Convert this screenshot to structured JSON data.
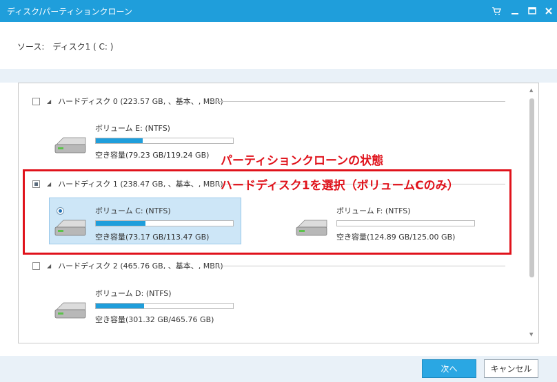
{
  "window": {
    "title": "ディスク/パーティションクローン",
    "icons": [
      "cart-icon",
      "minimize-icon",
      "maximize-icon",
      "close-icon"
    ]
  },
  "source_label": "ソース:　ディスク1 ( C: )",
  "disks": [
    {
      "label": "ハードディスク 0 (223.57 GB, 、基本、, MBR)",
      "checked": "unchecked",
      "volumes": [
        {
          "name": "ボリューム E: (NTFS)",
          "capacity": "空き容量(79.23 GB/119.24 GB)",
          "used_fraction": 0.34
        }
      ]
    },
    {
      "label": "ハードディスク 1 (238.47 GB, 、基本、, MBR)",
      "checked": "partial",
      "volumes": [
        {
          "name": "ボリューム C: (NTFS)",
          "capacity": "空き容量(73.17 GB/113.47 GB)",
          "used_fraction": 0.36,
          "selected": true
        },
        {
          "name": "ボリューム F: (NTFS)",
          "capacity": "空き容量(124.89 GB/125.00 GB)",
          "used_fraction": 0.0
        }
      ]
    },
    {
      "label": "ハードディスク 2 (465.76 GB, 、基本、, MBR)",
      "checked": "unchecked",
      "volumes": [
        {
          "name": "ボリューム D: (NTFS)",
          "capacity": "空き容量(301.32 GB/465.76 GB)",
          "used_fraction": 0.35
        }
      ]
    }
  ],
  "annotation": {
    "line1": "パーティションクローンの状態",
    "line2": "ハードディスク1を選択（ボリュームCのみ）",
    "color": "#e0121b"
  },
  "buttons": {
    "next": "次へ",
    "cancel": "キャンセル"
  },
  "colors": {
    "accent": "#1f9edb",
    "selection": "#cde6f7"
  }
}
